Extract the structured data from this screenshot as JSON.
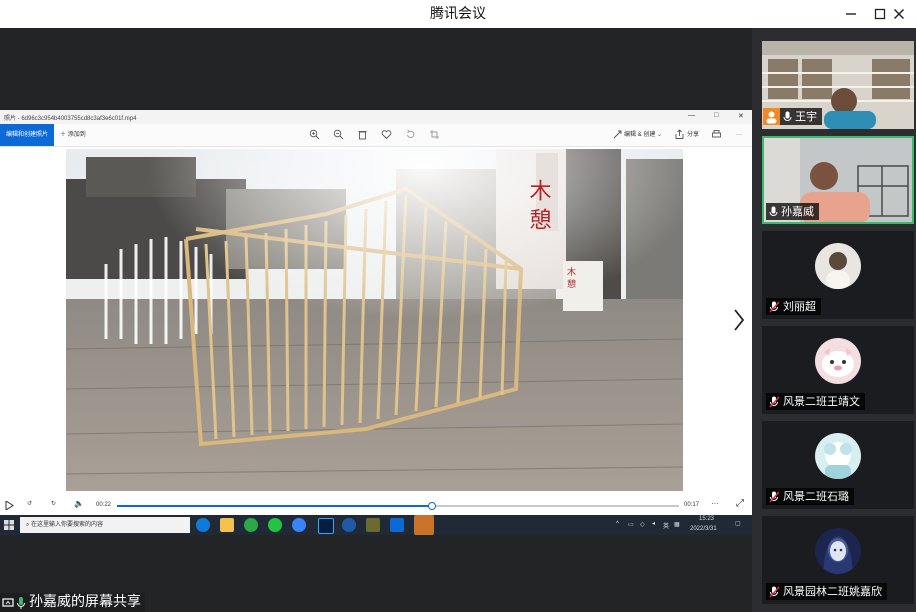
{
  "window": {
    "title": "腾讯会议",
    "controls": [
      "minimize-icon",
      "maximize-icon",
      "close-icon"
    ]
  },
  "shared_screen": {
    "photo_viewer": {
      "file_name": "照片 - 6d96c3c954b4003755cd8c3af3e6c01f.mp4",
      "toolbar": {
        "open_app_label": "编辑和创建照片",
        "add_to_label": "添加到",
        "edit_create_label": "编辑 & 创建",
        "share_label": "分享"
      },
      "player": {
        "current_time": "00:22",
        "remaining_time": "00:17",
        "progress": 0.56
      }
    },
    "taskbar": {
      "search_placeholder": "在这里输入你要搜索的内容",
      "clock_time": "15:23",
      "clock_date": "2022/3/31",
      "ime_label": "英"
    },
    "photo_signs": {
      "banner_text": "木 憩",
      "small_sign_text": "木 憩"
    }
  },
  "sharer_label": "孙嘉威的屏幕共享",
  "participants": [
    {
      "name": "王宇",
      "type": "video"
    },
    {
      "name": "孙嘉威",
      "type": "video",
      "active": true
    },
    {
      "name": "刘丽超",
      "type": "avatar"
    },
    {
      "name": "风景二班王靖文",
      "type": "avatar"
    },
    {
      "name": "风景二班石璐",
      "type": "avatar"
    },
    {
      "name": "风景园林二班姚嘉欣",
      "type": "avatar"
    }
  ],
  "colors": {
    "accent": "#0b6ad6",
    "active_speaker": "#3db96e",
    "muted_red": "#e0313a"
  }
}
